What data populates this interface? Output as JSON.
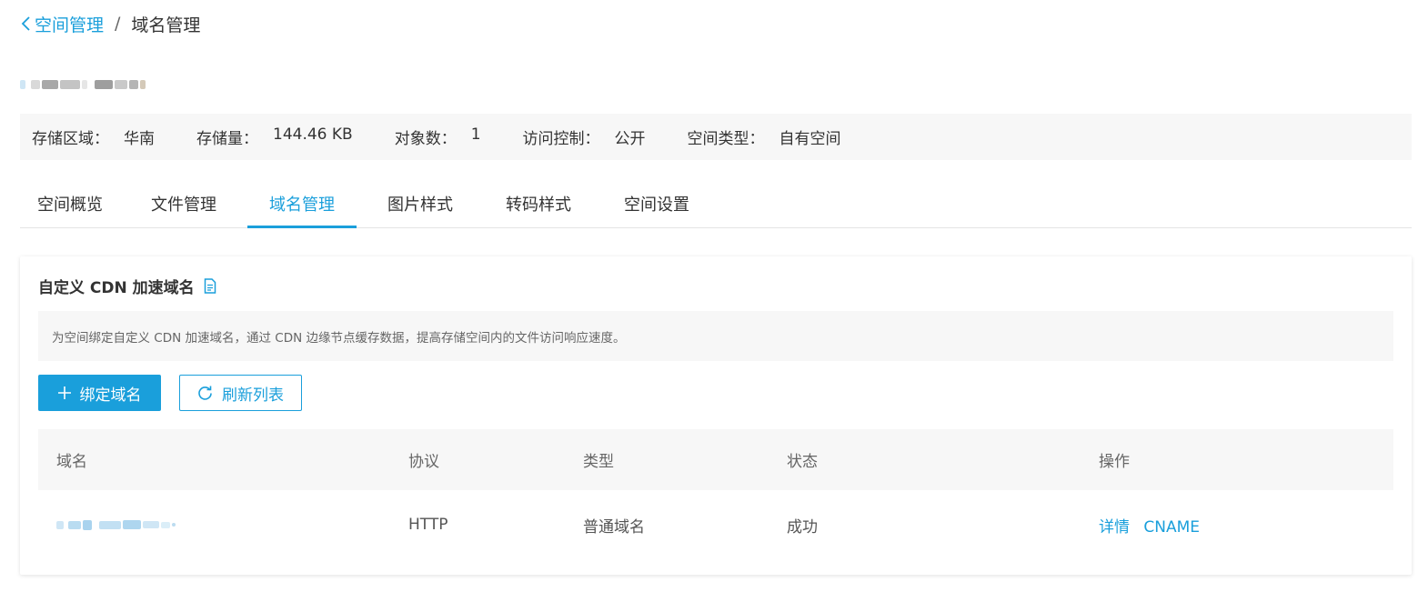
{
  "breadcrumb": {
    "back_label": "空间管理",
    "separator": "/",
    "current": "域名管理"
  },
  "info_bar": {
    "items": [
      {
        "label": "存储区域：",
        "value": "华南"
      },
      {
        "label": "存储量：",
        "value": "144.46 KB"
      },
      {
        "label": "对象数：",
        "value": "1"
      },
      {
        "label": "访问控制：",
        "value": "公开"
      },
      {
        "label": "空间类型：",
        "value": "自有空间"
      }
    ]
  },
  "tabs": [
    {
      "label": "空间概览"
    },
    {
      "label": "文件管理"
    },
    {
      "label": "域名管理",
      "active": true
    },
    {
      "label": "图片样式"
    },
    {
      "label": "转码样式"
    },
    {
      "label": "空间设置"
    }
  ],
  "panel": {
    "title": "自定义 CDN 加速域名",
    "title_icon": "document-icon",
    "notice": "为空间绑定自定义 CDN 加速域名，通过 CDN 边缘节点缓存数据，提高存储空间内的文件访问响应速度。",
    "bind_button": "绑定域名",
    "bind_icon": "plus-icon",
    "refresh_button": "刷新列表",
    "refresh_icon": "refresh-icon"
  },
  "table": {
    "headers": [
      "域名",
      "协议",
      "类型",
      "状态",
      "操作"
    ],
    "rows": [
      {
        "protocol": "HTTP",
        "type": "普通域名",
        "status": "成功",
        "actions": [
          "详情",
          "CNAME"
        ]
      }
    ]
  },
  "colors": {
    "accent": "#1a9fdb",
    "panel_bg": "#f7f7f7"
  }
}
